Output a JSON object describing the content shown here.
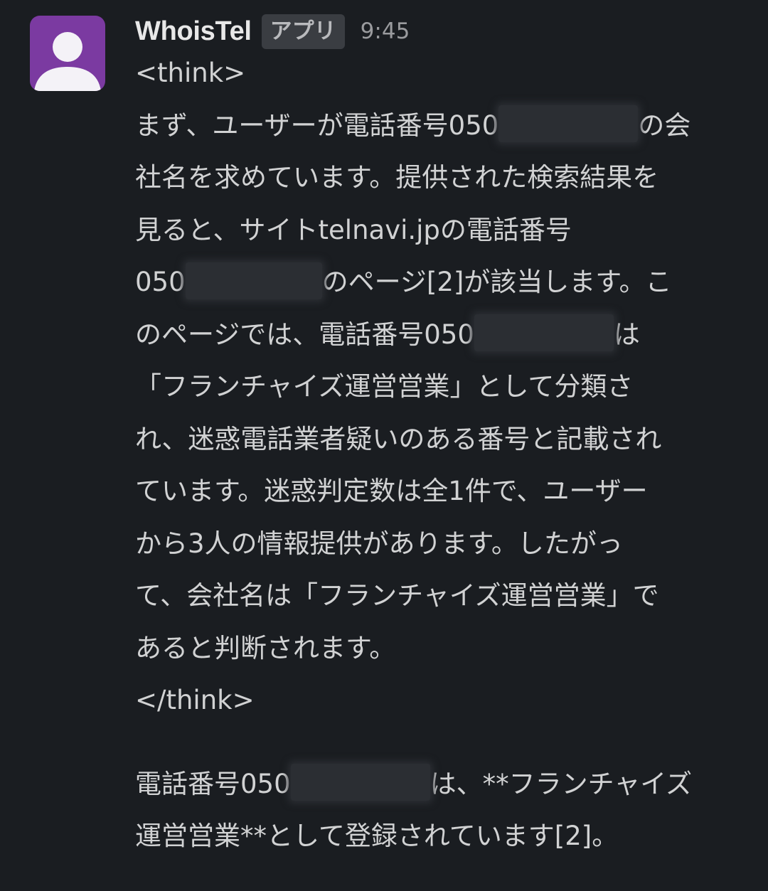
{
  "message": {
    "sender": "WhoisTel",
    "badge": "アプリ",
    "time": "9:45",
    "avatar_icon": "user-silhouette-icon",
    "avatar_color": "#7b3aa1",
    "lines": [
      "<think>",
      "まず、ユーザーが電話番号050",
      "の会",
      "社名を求めています。提供された検索結果を",
      "見ると、サイトtelnavi.jpの電話番号",
      "050",
      "のページ[2]が該当します。こ",
      "のページでは、電話番号050",
      "は",
      "「フランチャイズ運営営業」として分類さ",
      "れ、迷惑電話業者疑いのある番号と記載され",
      "ています。迷惑判定数は全1件で、ユーザー",
      "から3人の情報提供があります。したがっ",
      "て、会社名は「フランチャイズ運営営業」で",
      "あると判断されます。",
      "</think>",
      "電話番号050",
      "は、**フランチャイズ",
      "運営営業**として登録されています[2]。"
    ]
  }
}
